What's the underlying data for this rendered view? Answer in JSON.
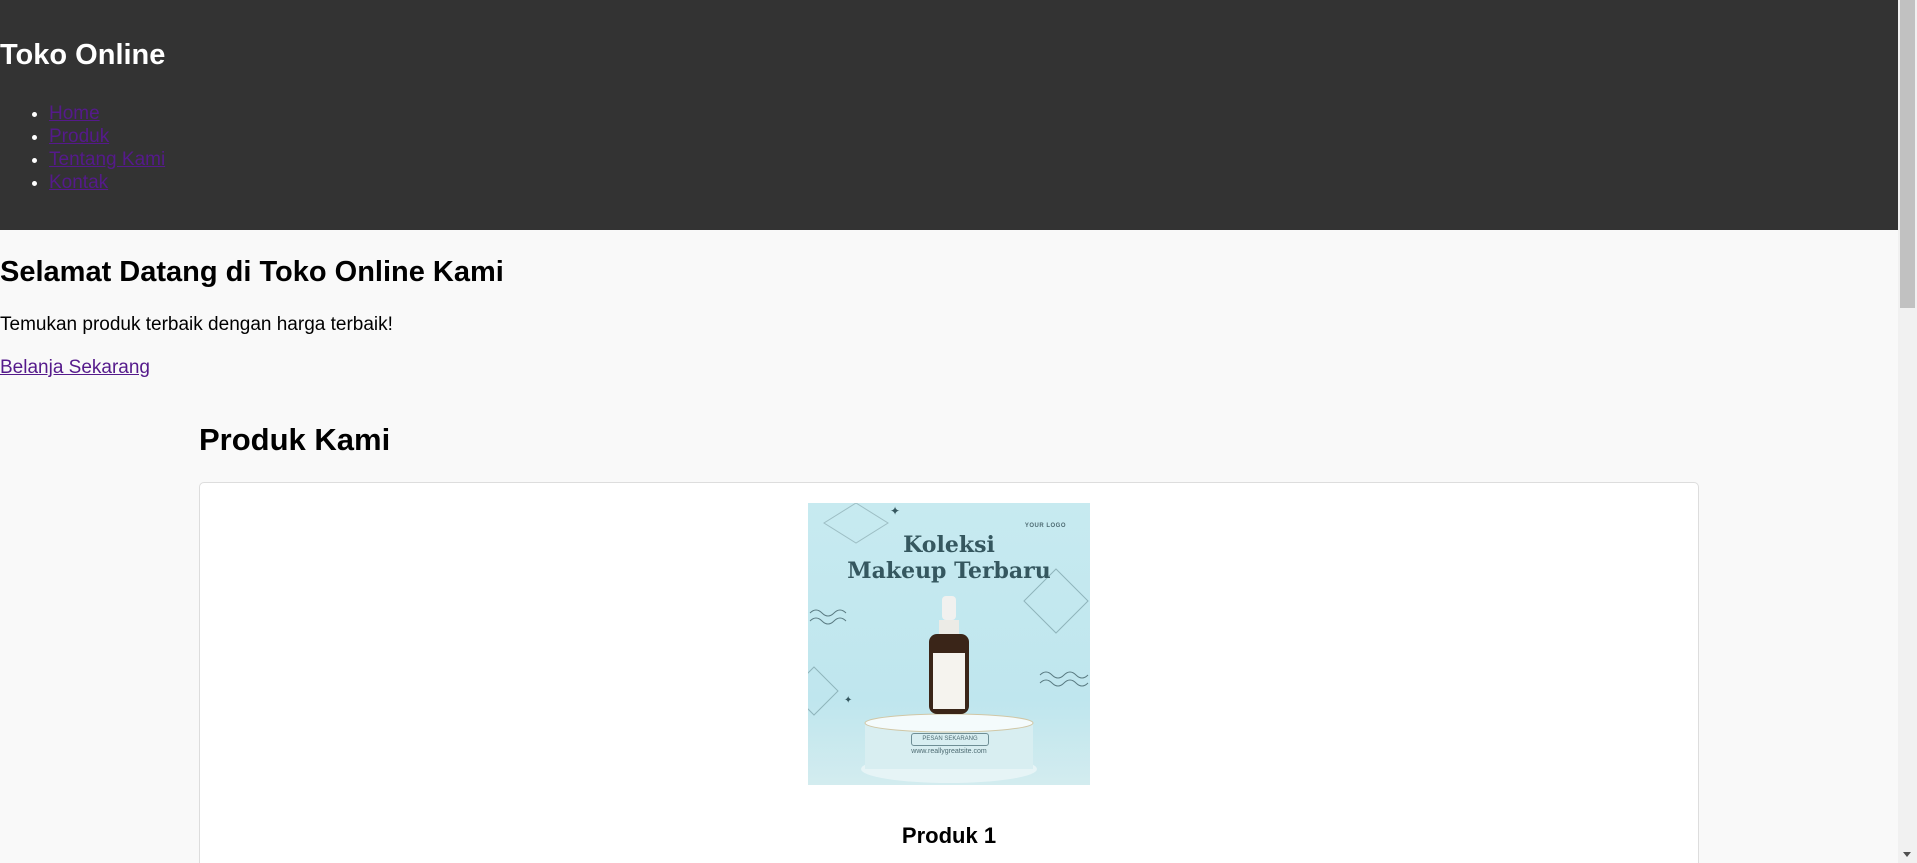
{
  "header": {
    "title": "Toko Online",
    "nav": [
      {
        "label": "Home"
      },
      {
        "label": "Produk"
      },
      {
        "label": "Tentang Kami"
      },
      {
        "label": "Kontak"
      }
    ]
  },
  "hero": {
    "heading": "Selamat Datang di Toko Online Kami",
    "subtext": "Temukan produk terbaik dengan harga terbaik!",
    "cta_label": "Belanja Sekarang"
  },
  "products": {
    "heading": "Produk Kami",
    "items": [
      {
        "name": "Produk 1",
        "image": {
          "logo_text": "YOUR LOGO",
          "headline_line1": "Koleksi",
          "headline_line2": "Makeup Terbaru",
          "button_text": "PESAN SEKARANG",
          "website": "www.reallygreatsite.com"
        }
      }
    ]
  },
  "colors": {
    "header_bg": "#333333",
    "page_bg": "#f9f9f9",
    "link_visited": "#551a8b",
    "image_bg": "#c7eaf0"
  }
}
